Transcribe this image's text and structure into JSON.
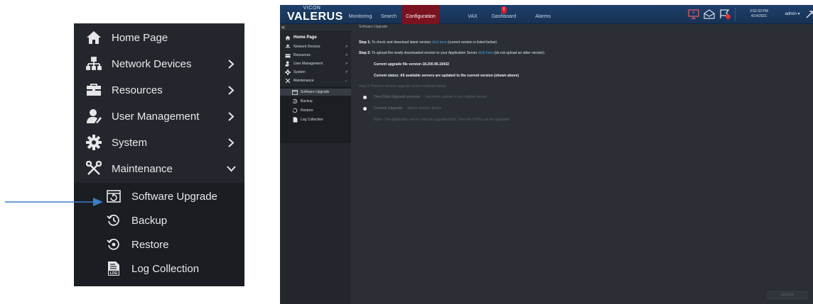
{
  "zoom_sidebar": {
    "items": [
      {
        "label": "Home Page",
        "icon": "home-icon",
        "chevron": false
      },
      {
        "label": "Network Devices",
        "icon": "network-icon",
        "chevron": "right"
      },
      {
        "label": "Resources",
        "icon": "toolbox-icon",
        "chevron": "right"
      },
      {
        "label": "User Management",
        "icon": "user-icon",
        "chevron": "right"
      },
      {
        "label": "System",
        "icon": "gear-icon",
        "chevron": "right"
      },
      {
        "label": "Maintenance",
        "icon": "tools-icon",
        "chevron": "down"
      }
    ],
    "sub_items": [
      {
        "label": "Software Upgrade",
        "icon": "upgrade-icon"
      },
      {
        "label": "Backup",
        "icon": "backup-icon"
      },
      {
        "label": "Restore",
        "icon": "restore-icon"
      },
      {
        "label": "Log Collection",
        "icon": "log-file-icon",
        "icon_text": "LOG"
      }
    ]
  },
  "app": {
    "logo_small": "VICON",
    "logo_main": "VALERUS",
    "nav_tabs": [
      {
        "label": "Monitoring"
      },
      {
        "label": "Search"
      },
      {
        "label": "Configuration",
        "active": true
      },
      {
        "label": "VAX"
      },
      {
        "label": "Dashboard",
        "alert": "!"
      },
      {
        "label": "Alarms"
      }
    ],
    "clock_time": "2:52:33 PM",
    "clock_date": "4/14/2021",
    "user": "admin ▾",
    "collapse": "«",
    "breadcrumb": "Software Upgrade",
    "sidebar": {
      "items": [
        {
          "label": "Home Page"
        },
        {
          "label": "Network Devices",
          "chevron": ">"
        },
        {
          "label": "Resources",
          "chevron": ">"
        },
        {
          "label": "User Management",
          "chevron": ">"
        },
        {
          "label": "System",
          "chevron": ">"
        },
        {
          "label": "Maintenance",
          "chevron": "⌄"
        }
      ],
      "sub_items": [
        {
          "label": "Software Upgrade"
        },
        {
          "label": "Backup"
        },
        {
          "label": "Restore"
        },
        {
          "label": "Log Collection"
        }
      ]
    },
    "content": {
      "step1_prefix": "Step 1:",
      "step1_text": " To check and download latest version ",
      "step1_link": "click here",
      "step1_suffix": " (current version is listed below)",
      "step2_prefix": "Step 2:",
      "step2_text": " To upload the newly downloaded version to your Application Server ",
      "step2_link": "click here",
      "step2_suffix": " (do not upload an older version)",
      "current_version": "Current upgrade file version 18.200.96.19432",
      "current_status": "Current status: All available servers are updated to the current version (shown above)",
      "step3": "Step 3: Perform version upgrade (select method below)",
      "option1_title": "One-Click Upgrade process",
      "option1_desc": "- Automatic update to any eligible device",
      "option2_title": "Custom Upgrade",
      "option2_desc": "- Select specific device",
      "note": "Note - The application server must be upgraded first. Then the NVRs can be upgraded",
      "upgrade_button": "Upgrade"
    }
  },
  "colors": {
    "sidebar_bg": "#23272d",
    "topbar_bg": "#1e3f6b",
    "active_tab": "#7b1220",
    "link": "#4a9fe6",
    "arrow": "#3a7dc9"
  }
}
